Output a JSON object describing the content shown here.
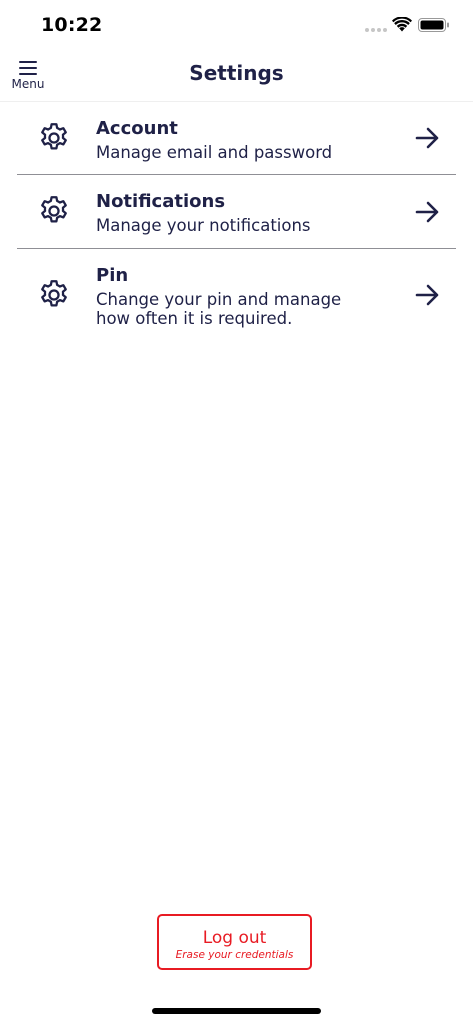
{
  "status_bar": {
    "time": "10:22",
    "icons": [
      "signal-icon",
      "wifi-icon",
      "battery-icon"
    ]
  },
  "header": {
    "menu_label": "Menu",
    "menu_icon": "hamburger-icon",
    "title": "Settings"
  },
  "settings": {
    "items": [
      {
        "title": "Account",
        "description": "Manage email and password",
        "icon": "gear-icon",
        "action_icon": "arrow-right-icon"
      },
      {
        "title": "Notifications",
        "description": "Manage your notifications",
        "icon": "gear-icon",
        "action_icon": "arrow-right-icon"
      },
      {
        "title": "Pin",
        "description_line1": "Change your pin and manage",
        "description_line2": "how often it is required.",
        "icon": "gear-icon",
        "action_icon": "arrow-right-icon"
      }
    ]
  },
  "logout": {
    "label": "Log out",
    "sublabel": "Erase your credentials"
  },
  "colors": {
    "text": "#1f2147",
    "divider": "#8f8f95",
    "danger": "#e81b23",
    "background": "#ffffff"
  }
}
